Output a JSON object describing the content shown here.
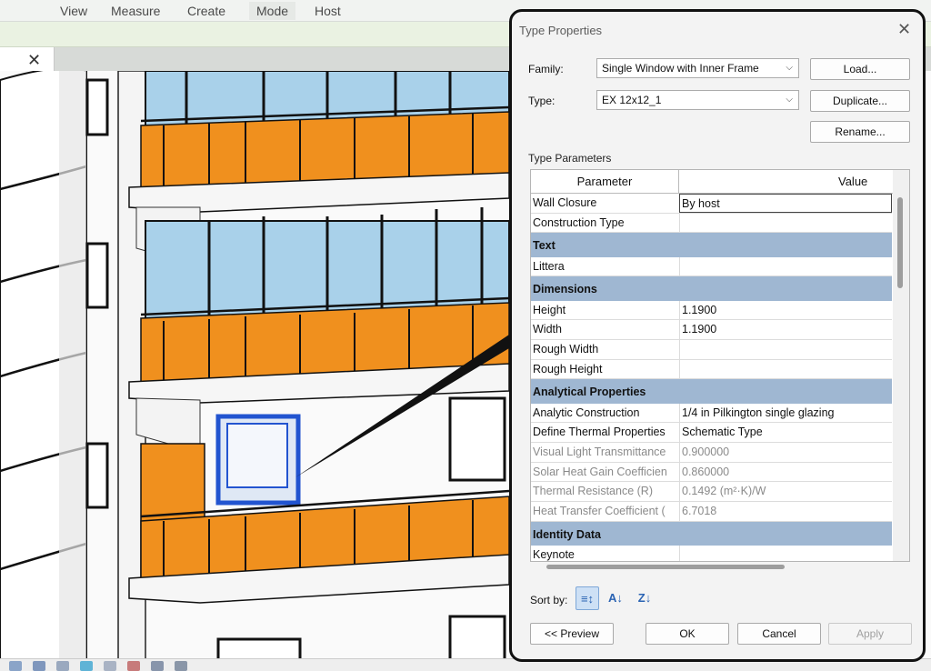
{
  "ribbon": {
    "tabs": [
      "View",
      "Measure",
      "Create",
      "Mode",
      "Host"
    ]
  },
  "viewtab": {
    "close_glyph": "✕"
  },
  "dialog": {
    "title": "Type Properties",
    "close_glyph": "✕",
    "family_label": "Family:",
    "family_value": "Single Window with Inner Frame",
    "type_label": "Type:",
    "type_value": "EX 12x12_1",
    "load_button": "Load...",
    "duplicate_button": "Duplicate...",
    "rename_button": "Rename...",
    "type_parameters_label": "Type Parameters",
    "grid": {
      "header_parameter": "Parameter",
      "header_value": "Value",
      "rows": [
        {
          "kind": "row",
          "parameter": "Wall Closure",
          "value": "By host",
          "editing": true
        },
        {
          "kind": "row",
          "parameter": "Construction Type",
          "value": ""
        },
        {
          "kind": "group",
          "parameter": "Text"
        },
        {
          "kind": "row",
          "parameter": "Littera",
          "value": ""
        },
        {
          "kind": "group",
          "parameter": "Dimensions"
        },
        {
          "kind": "row",
          "parameter": "Height",
          "value": "1.1900"
        },
        {
          "kind": "row",
          "parameter": "Width",
          "value": "1.1900"
        },
        {
          "kind": "row",
          "parameter": "Rough Width",
          "value": ""
        },
        {
          "kind": "row",
          "parameter": "Rough Height",
          "value": ""
        },
        {
          "kind": "group",
          "parameter": "Analytical Properties"
        },
        {
          "kind": "row",
          "parameter": "Analytic Construction",
          "value": "1/4 in Pilkington single glazing"
        },
        {
          "kind": "row",
          "parameter": "Define Thermal Properties",
          "value": "Schematic Type"
        },
        {
          "kind": "row",
          "parameter": "Visual Light Transmittance",
          "value": "0.900000",
          "grey": true
        },
        {
          "kind": "row",
          "parameter": "Solar Heat Gain Coefficien",
          "value": "0.860000",
          "grey": true
        },
        {
          "kind": "row",
          "parameter": "Thermal Resistance (R)",
          "value": "0.1492 (m²·K)/W",
          "grey": true
        },
        {
          "kind": "row",
          "parameter": "Heat Transfer Coefficient (",
          "value": "6.7018",
          "grey": true
        },
        {
          "kind": "group",
          "parameter": "Identity Data"
        },
        {
          "kind": "row",
          "parameter": "Keynote",
          "value": ""
        }
      ]
    },
    "sort_by_label": "Sort by:",
    "preview_button": "<< Preview",
    "ok_button": "OK",
    "cancel_button": "Cancel",
    "apply_button": "Apply"
  },
  "colors": {
    "group_header": "#9fb7d2",
    "railing_orange": "#f0901e",
    "glass_blue": "#a9d1ea"
  }
}
